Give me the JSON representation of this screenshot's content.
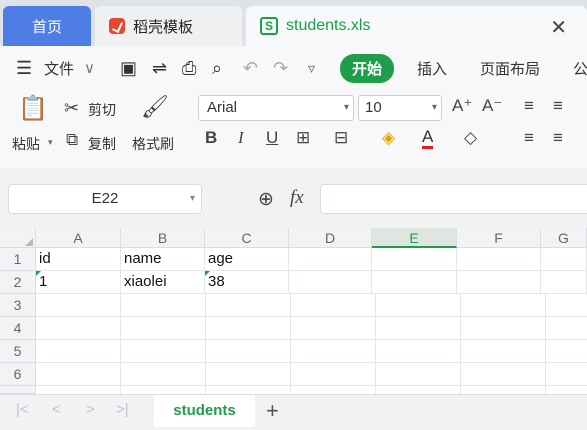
{
  "tabs": {
    "home": "首页",
    "templates": "稻壳模板",
    "file": "students.xls",
    "file_icon": "S",
    "close": "✕"
  },
  "toolbar1": {
    "menu_icon": "☰",
    "file_menu": "文件",
    "chevron": "∨",
    "save_icon": "▣",
    "export_icon": "⇌",
    "print_icon": "⎙",
    "preview_icon": "⌕",
    "undo_icon": "↶",
    "redo_icon": "↷",
    "more_icon": "▿",
    "start": "开始",
    "insert": "插入",
    "page_layout": "页面布局",
    "formula_cut": "公"
  },
  "toolbar2": {
    "paste": "粘贴",
    "paste_icon": "📋",
    "cut": "剪切",
    "cut_icon": "✂",
    "copy": "复制",
    "copy_icon": "⧉",
    "format_painter": "格式刷",
    "painter_icon": "🖌",
    "font": "Arial",
    "size": "10",
    "grow_font": "A⁺",
    "shrink_font": "A⁻",
    "bold": "B",
    "italic": "I",
    "underline": "U",
    "border_icon": "⊞",
    "merge_icon": "⊟",
    "fill_icon": "◈",
    "font_color": "A",
    "clear_icon": "◇",
    "align_top": "≡",
    "align_mid": "≡",
    "align_left": "≡",
    "align_center": "≡"
  },
  "formula_bar": {
    "name_box": "E22",
    "zoom_icon": "⊕",
    "fx": "fx",
    "content": ""
  },
  "columns": [
    "A",
    "B",
    "C",
    "D",
    "E",
    "F",
    "G"
  ],
  "rows": [
    "1",
    "2",
    "3",
    "4",
    "5",
    "6"
  ],
  "cells": {
    "A1": "id",
    "B1": "name",
    "C1": "age",
    "A2": "1",
    "B2": "xiaolei",
    "C2": "38"
  },
  "sheetbar": {
    "first": "|<",
    "prev": "<",
    "next": ">",
    "last": ">|",
    "sheet_name": "students",
    "add": "+"
  },
  "colors": {
    "accent": "#1e9e4b",
    "home_tab": "#4f7de6",
    "selected_col": "#dfe6df"
  }
}
